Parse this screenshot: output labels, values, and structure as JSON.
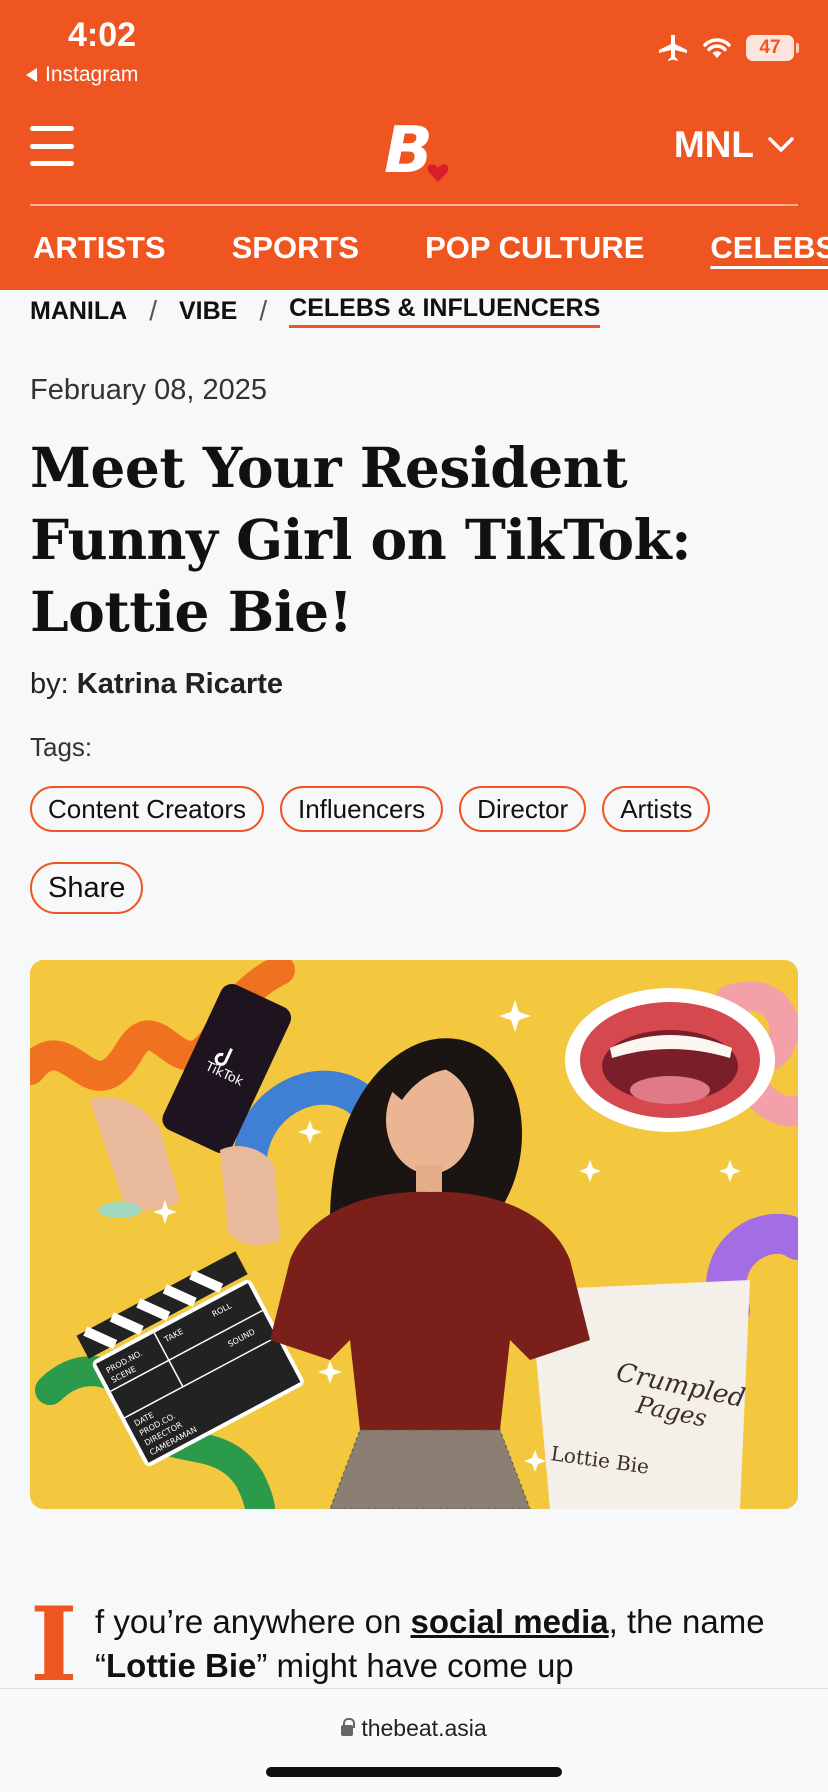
{
  "status_bar": {
    "time": "4:02",
    "back_app": "Instagram",
    "battery": "47"
  },
  "header": {
    "logo_letter": "B",
    "city": "MNL",
    "nav": [
      "ARTISTS",
      "SPORTS",
      "POP CULTURE",
      "CELEBS"
    ]
  },
  "breadcrumb": {
    "items": [
      "MANILA",
      "VIBE",
      "CELEBS & INFLUENCERS"
    ],
    "separator": "/"
  },
  "article": {
    "date": "February 08, 2025",
    "title": "Meet Your Resident Funny Girl on TikTok: Lottie Bie!",
    "by_label": "by:",
    "author": "Katrina Ricarte",
    "tags_label": "Tags:",
    "tags": [
      "Content Creators",
      "Influencers",
      "Director",
      "Artists"
    ],
    "share_label": "Share",
    "drop_cap": "I",
    "body_part1": "f you’re anywhere on ",
    "body_link": "social media",
    "body_part2": ", the name “",
    "body_bold": "Lottie Bie",
    "body_part3": "” might have come up"
  },
  "hero_image": {
    "phone_app": "TikTok",
    "paper_title_1": "Crumpled",
    "paper_title_2": "Pages",
    "paper_author": "Lottie Bie",
    "clapper_labels": [
      "PROD.NO.",
      "SCENE",
      "TAKE",
      "ROLL",
      "SOUND",
      "DATE",
      "PROD.CO.",
      "DIRECTOR",
      "CAMERAMAN"
    ]
  },
  "browser": {
    "url": "thebeat.asia"
  },
  "colors": {
    "brand": "#ef5520",
    "hero_bg": "#f3c73e"
  }
}
